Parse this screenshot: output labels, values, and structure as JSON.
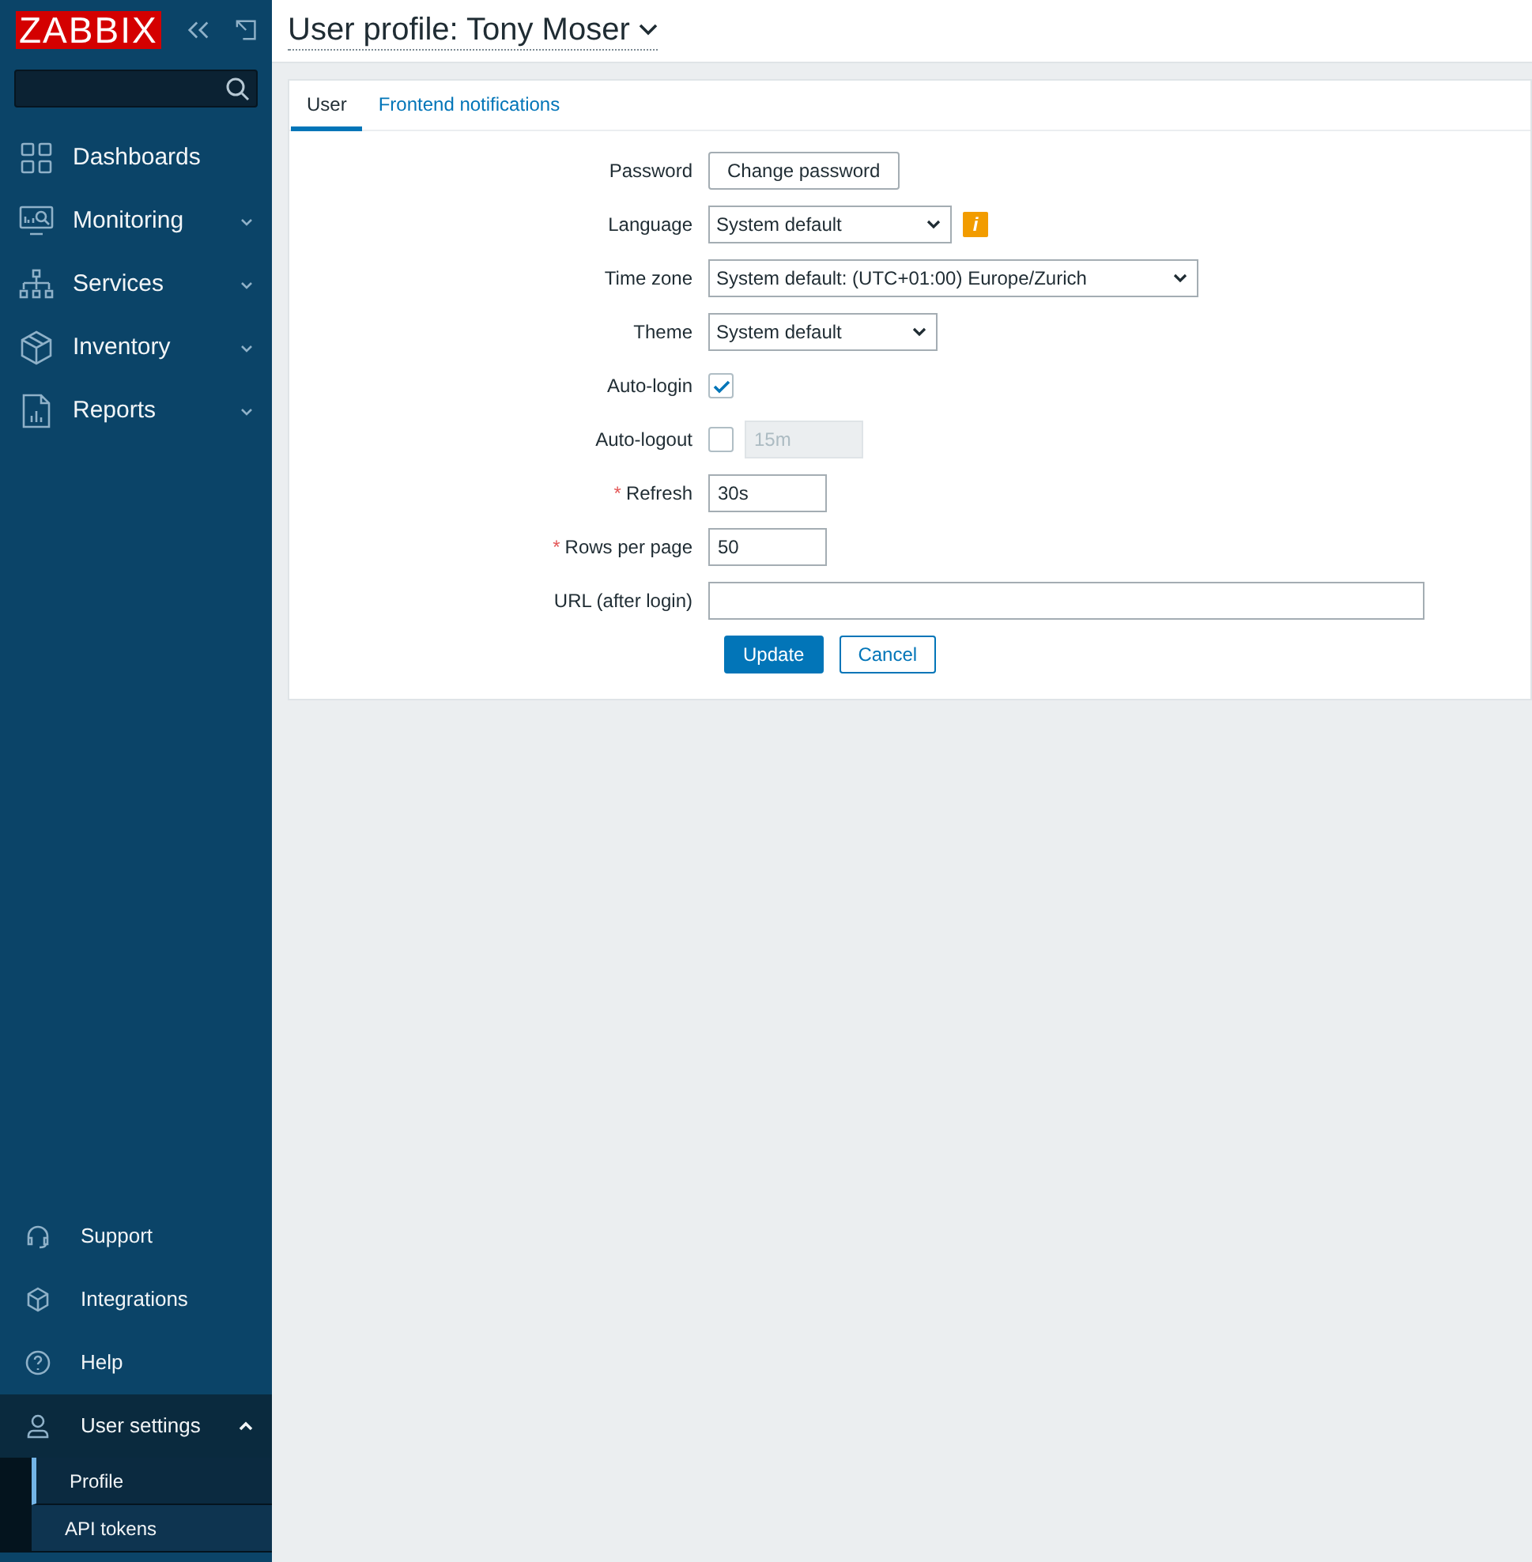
{
  "logo": "ZABBIX",
  "sidebar": {
    "items": [
      {
        "label": "Dashboards",
        "kind": "grid",
        "expanded": false,
        "expandable": false
      },
      {
        "label": "Monitoring",
        "kind": "monitor",
        "expandable": true,
        "expanded": false
      },
      {
        "label": "Services",
        "kind": "tree",
        "expandable": true,
        "expanded": false
      },
      {
        "label": "Inventory",
        "kind": "box",
        "expandable": true,
        "expanded": false
      },
      {
        "label": "Reports",
        "kind": "report",
        "expandable": true,
        "expanded": false
      }
    ],
    "bottom_items": [
      {
        "label": "Support",
        "kind": "headset",
        "expandable": false,
        "expanded": false
      },
      {
        "label": "Integrations",
        "kind": "cube",
        "expandable": false,
        "expanded": false
      },
      {
        "label": "Help",
        "kind": "help",
        "expandable": false,
        "expanded": false
      },
      {
        "label": "User settings",
        "kind": "user",
        "expandable": true,
        "expanded": true,
        "children": [
          {
            "label": "Profile",
            "selected": true
          },
          {
            "label": "API tokens",
            "selected": false
          }
        ]
      }
    ]
  },
  "page_title": "User profile: Tony Moser",
  "tabs": [
    {
      "label": "User",
      "selected": true
    },
    {
      "label": "Frontend notifications",
      "selected": false
    }
  ],
  "form": {
    "rows": [
      {
        "label": "Password",
        "kind": "button",
        "value": "Change password"
      },
      {
        "label": "Language",
        "kind": "select",
        "value": "System default",
        "info": "i"
      },
      {
        "label": "Time zone",
        "kind": "select",
        "value": "System default: (UTC+01:00) Europe/Zurich"
      },
      {
        "label": "Theme",
        "kind": "select",
        "value": "System default"
      },
      {
        "label": "Auto-login",
        "kind": "checkbox",
        "checked": true
      },
      {
        "label": "Auto-logout",
        "kind": "checkbox_input",
        "checked": false,
        "value": "15m",
        "disabled": true
      },
      {
        "label": "Refresh",
        "kind": "input",
        "value": "30s",
        "marker": "*"
      },
      {
        "label": "Rows per page",
        "kind": "input",
        "value": "50",
        "marker": "*"
      },
      {
        "label": "URL (after login)",
        "kind": "input"
      }
    ],
    "buttons": [
      {
        "label": "Update",
        "primary": true
      },
      {
        "label": "Cancel",
        "primary": false
      }
    ]
  }
}
